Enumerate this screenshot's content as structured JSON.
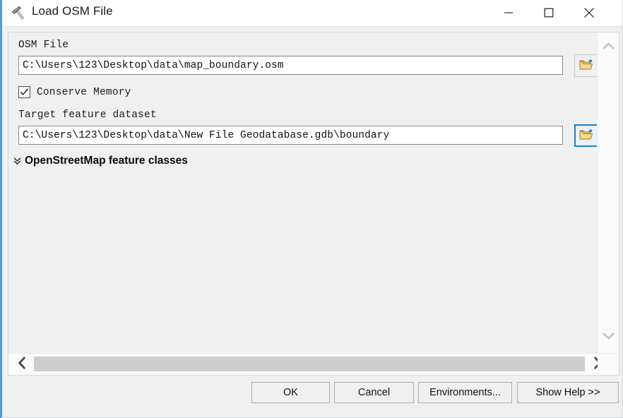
{
  "window": {
    "title": "Load OSM File",
    "icon": "hammer-tool-icon",
    "accent_color": "#4c9fd0",
    "controls": {
      "minimize": "minimize-icon",
      "maximize": "maximize-icon",
      "close": "close-icon"
    }
  },
  "form": {
    "osm_file": {
      "label": "OSM File",
      "value": "C:\\Users\\123\\Desktop\\data\\map_boundary.osm",
      "placeholder": "",
      "browse_icon": "folder-open-icon"
    },
    "conserve_memory": {
      "label": "Conserve Memory",
      "checked": true
    },
    "target_feature_dataset": {
      "label": "Target feature dataset",
      "value": "C:\\Users\\123\\Desktop\\data\\New File Geodatabase.gdb\\boundary",
      "placeholder": "",
      "browse_icon": "folder-open-icon",
      "browse_focused": true
    },
    "expander": {
      "label": "OpenStreetMap feature classes",
      "chevron_icon": "double-chevron-down-icon",
      "expanded": false
    }
  },
  "scrollbars": {
    "vertical": {
      "up_icon": "chevron-up-icon",
      "down_icon": "chevron-down-icon"
    },
    "horizontal": {
      "left_icon": "chevron-left-icon",
      "right_icon": "chevron-right-icon"
    }
  },
  "footer": {
    "ok": "OK",
    "cancel": "Cancel",
    "environments": "Environments...",
    "show_help": "Show Help >>"
  }
}
